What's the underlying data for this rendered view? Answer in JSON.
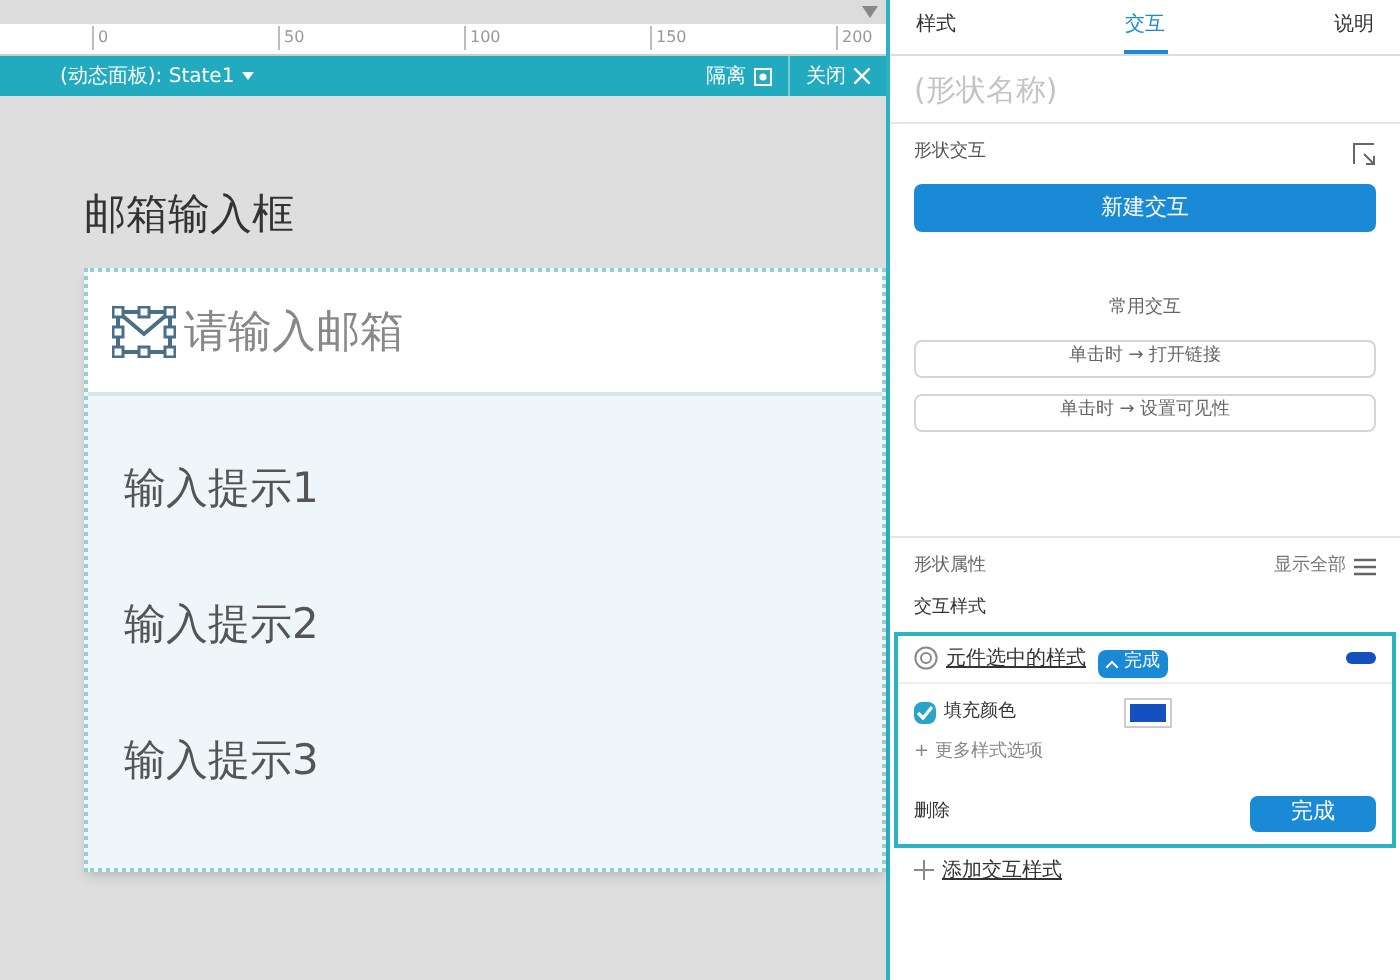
{
  "ruler": {
    "ticks": [
      "0",
      "50",
      "100",
      "150",
      "200"
    ]
  },
  "panel_bar": {
    "title": "(动态面板): State1",
    "isolate": "隔离",
    "close": "关闭"
  },
  "canvas": {
    "heading": "邮箱输入框",
    "email_field": {
      "placeholder": "请输入邮箱"
    },
    "suggestions": [
      "输入提示1",
      "输入提示2",
      "输入提示3"
    ]
  },
  "inspector": {
    "tabs": [
      {
        "label": "样式",
        "selected": false
      },
      {
        "label": "交互",
        "selected": true
      },
      {
        "label": "说明",
        "selected": false
      }
    ],
    "shape_name": {
      "placeholder": "(形状名称)"
    },
    "shape_interactions": "形状交互",
    "new_interaction": "新建交互",
    "common_label": "常用交互",
    "common": [
      "单击时 → 打开链接",
      "单击时 → 设置可见性"
    ],
    "properties": "形状属性",
    "show_all": "显示全部",
    "interaction_styles": "交互样式",
    "style_editor": {
      "title": "元件选中的样式",
      "done_tag": "完成",
      "fill": {
        "label": "填充颜色",
        "checked": true
      },
      "more": "+ 更多样式选项",
      "delete": "删除",
      "done": "完成"
    },
    "add_style": "添加交互样式"
  }
}
